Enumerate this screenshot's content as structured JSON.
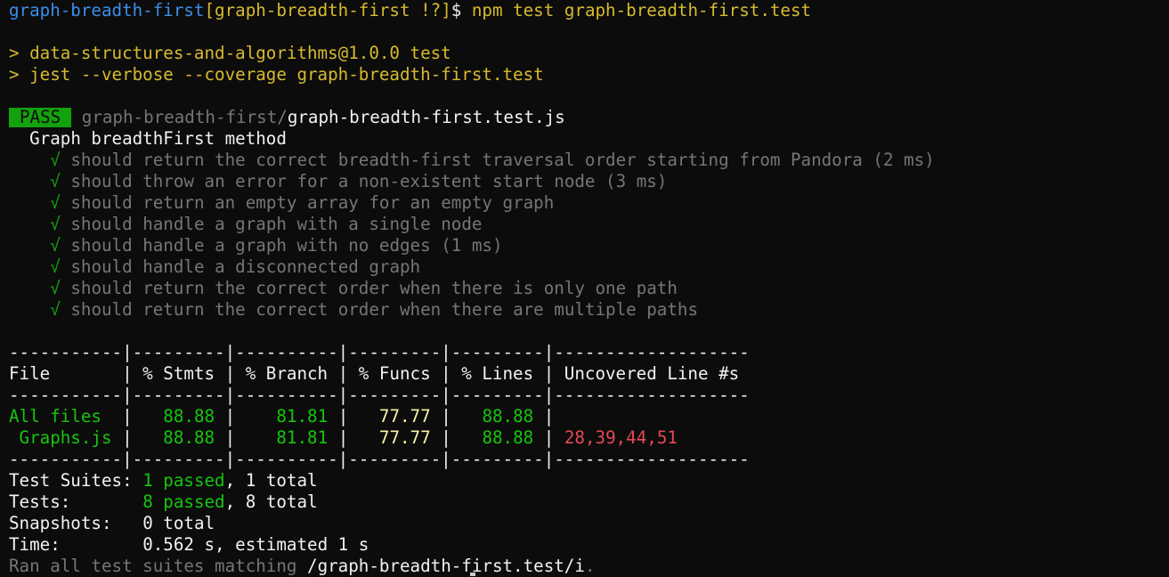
{
  "prompt": {
    "dir": "graph-breadth-first",
    "branch": "[graph-breadth-first !?]",
    "symbol": "$",
    "command": "npm test graph-breadth-first.test"
  },
  "npm": {
    "line1": "> data-structures-and-algorithms@1.0.0 test",
    "line2": "> jest --verbose --coverage graph-breadth-first.test"
  },
  "result": {
    "badge": "PASS",
    "path_dir": "graph-breadth-first/",
    "path_file": "graph-breadth-first.test.js",
    "describe": "Graph breadthFirst method",
    "check_glyph": "√",
    "tests": [
      "should return the correct breadth-first traversal order starting from Pandora (2 ms)",
      "should throw an error for a non-existent start node (3 ms)",
      "should return an empty array for an empty graph",
      "should handle a graph with a single node",
      "should handle a graph with no edges (1 ms)",
      "should handle a disconnected graph",
      "should return the correct order when there is only one path",
      "should return the correct order when there are multiple paths"
    ]
  },
  "coverage": {
    "separator": "-----------|---------|----------|---------|---------|-------------------",
    "header": "File       | % Stmts | % Branch | % Funcs | % Lines | Uncovered Line #s ",
    "rows": [
      {
        "file": "All files ",
        "stmts": "88.88",
        "branch": "81.81",
        "funcs": "77.77",
        "lines": "88.88",
        "uncovered": ""
      },
      {
        "file": " Graphs.js",
        "stmts": "88.88",
        "branch": "81.81",
        "funcs": "77.77",
        "lines": "88.88",
        "uncovered": "28,39,44,51"
      }
    ]
  },
  "summary": {
    "suites_label": "Test Suites: ",
    "suites_passed": "1 passed",
    "suites_total": ", 1 total",
    "tests_label": "Tests:       ",
    "tests_passed": "8 passed",
    "tests_total": ", 8 total",
    "snapshots_label": "Snapshots:   ",
    "snapshots_value": "0 total",
    "time_label": "Time:        ",
    "time_value": "0.562 s, estimated 1 s",
    "ran_label": "Ran all test suites matching ",
    "ran_pattern": "/graph-breadth-first.test/i",
    "ran_end": "."
  },
  "colors": {
    "background": "#0c0c0c",
    "pass_badge": "#13a10e",
    "green": "#16c60c",
    "yellow": "#f9f1a5",
    "red": "#e74856",
    "blue": "#3b8eea"
  }
}
